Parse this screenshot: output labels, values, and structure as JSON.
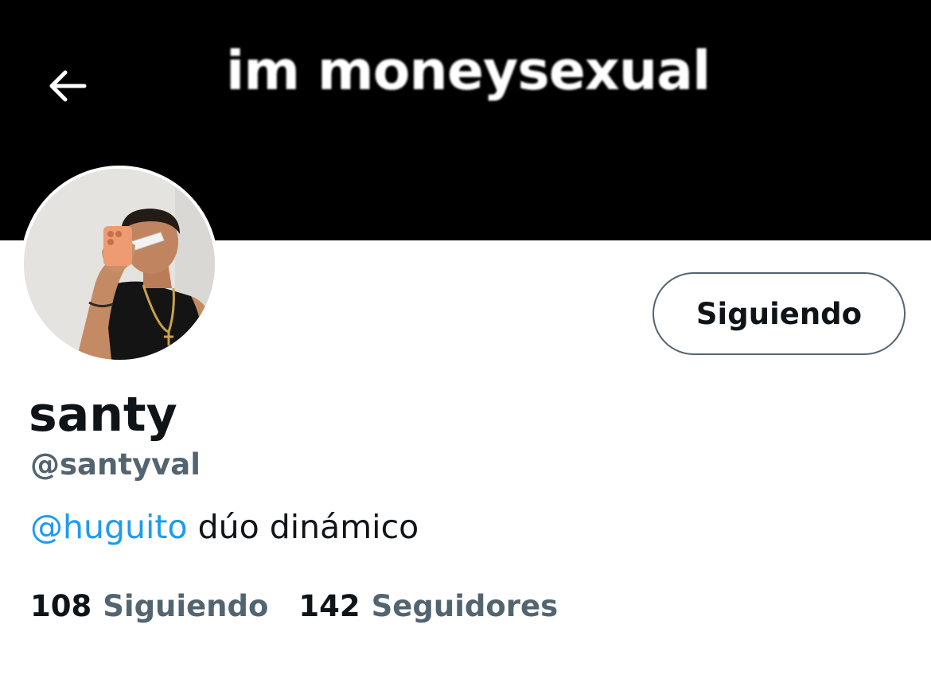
{
  "header": {
    "banner_text": "im moneysexual",
    "back_icon": "arrow-left-icon"
  },
  "profile": {
    "display_name": "santy",
    "handle": "@santyval",
    "follow_button_label": "Siguiendo",
    "bio": {
      "mention": "@huguito",
      "text": " dúo dinámico"
    },
    "stats": {
      "following_count": "108",
      "following_label": "Siguiendo",
      "followers_count": "142",
      "followers_label": "Seguidores"
    }
  },
  "colors": {
    "banner": "#000000",
    "text_primary": "#0f1419",
    "text_secondary": "#536471",
    "link": "#1d9bf0"
  }
}
